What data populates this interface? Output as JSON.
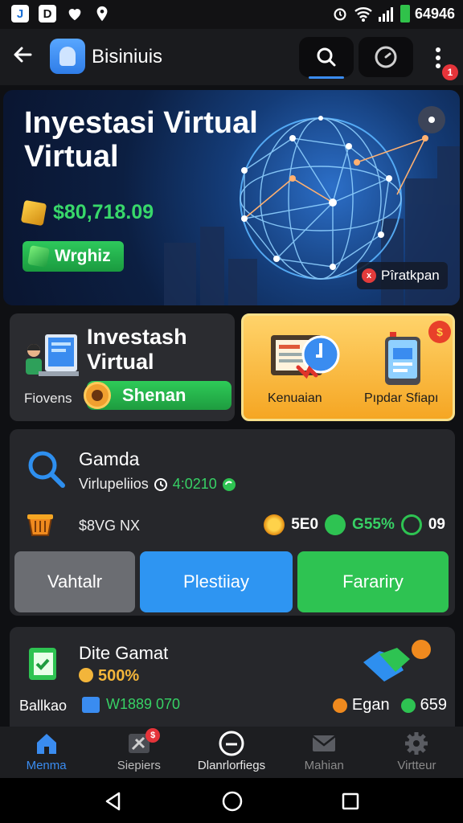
{
  "status_bar": {
    "left_icons": [
      "app-j-icon",
      "app-d-icon",
      "heart-icon",
      "location-icon"
    ],
    "right_text": "64946"
  },
  "app_bar": {
    "title": "Bisiniuis",
    "badge": "1"
  },
  "hero": {
    "title": "Inyestasi Virtual Virtual",
    "amount": "$80,718.09",
    "chip": "Wrghiz",
    "tag": "Pîratkpan",
    "tag_icon": "x"
  },
  "card_left": {
    "title": "Investash Virtual",
    "subtitle": "Fiovens",
    "button": "Shenan"
  },
  "card_right": {
    "label_a": "Kenuaian",
    "label_b": "Pıpdar Sfiapı",
    "badge": "$"
  },
  "panel": {
    "title": "Gamda",
    "subtitle": "Virlupeliios",
    "time": "4:0210",
    "stats": "$8VG NX",
    "right_a": "5E0",
    "right_b": "G55%",
    "right_c": "09",
    "btn_a": "Vahtalr",
    "btn_b": "Plestiiay",
    "btn_c": "Farariry"
  },
  "card2": {
    "title": "Dite Gamat",
    "pct": "500%",
    "left": "Ballkao",
    "code": "W1889 070",
    "right_a": "Egan",
    "right_b": "659"
  },
  "nav": {
    "items": [
      {
        "label": "Menma"
      },
      {
        "label": "Siepiers"
      },
      {
        "label": "Dlanrlorfiegs"
      },
      {
        "label": "Mahian"
      },
      {
        "label": "Virtteur"
      }
    ],
    "badge": "$"
  },
  "colors": {
    "accent_blue": "#3a8cf0",
    "green": "#2ec352",
    "gold": "#f5a623",
    "background": "#0f1013"
  }
}
